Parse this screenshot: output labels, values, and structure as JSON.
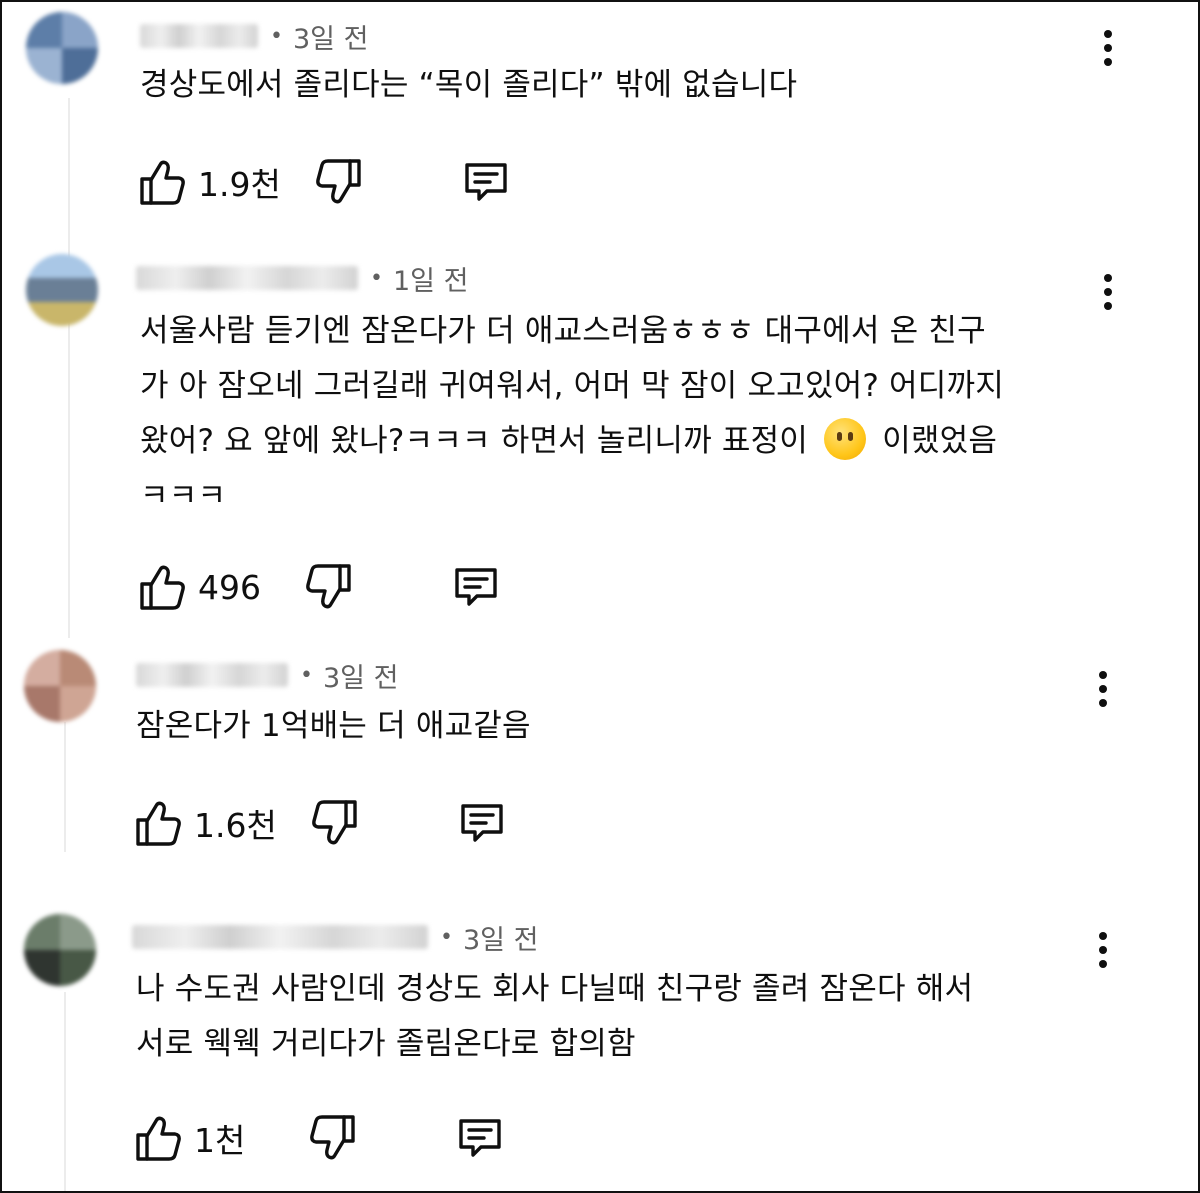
{
  "comments": [
    {
      "time": "3일 전",
      "lines": [
        "경상도에서 졸리다는 “목이 졸리다” 밖에 없습니다"
      ],
      "likes": "1.9천"
    },
    {
      "time": "1일 전",
      "lines": [
        "서울사람 듣기엔 잠온다가 더 애교스러움ㅎㅎㅎ 대구에서 온 친구",
        "가 아 잠오네 그러길래 귀여워서, 어머 막 잠이 오고있어? 어디까지",
        "왔어? 요 앞에 왔나?ㅋㅋㅋ 하면서 놀리니까 표정이",
        "ㅋㅋㅋ"
      ],
      "line3_tail": "이랬었음",
      "emoji": "face-without-mouth-emoji",
      "likes": "496"
    },
    {
      "time": "3일 전",
      "lines": [
        "잠온다가 1억배는 더 애교같음"
      ],
      "likes": "1.6천"
    },
    {
      "time": "3일 전",
      "lines": [
        "나 수도권 사람인데 경상도 회사 다닐때 친구랑 졸려 잠온다 해서",
        "서로 웩웩 거리다가 졸림온다로 합의함"
      ],
      "likes": "1천"
    }
  ],
  "icons": {
    "like": "thumbs-up-icon",
    "dislike": "thumbs-down-icon",
    "reply": "reply-comment-icon",
    "menu": "more-vertical-icon"
  },
  "colors": {
    "text": "#0f0f0f",
    "meta": "#606060",
    "thread": "#ececec"
  }
}
